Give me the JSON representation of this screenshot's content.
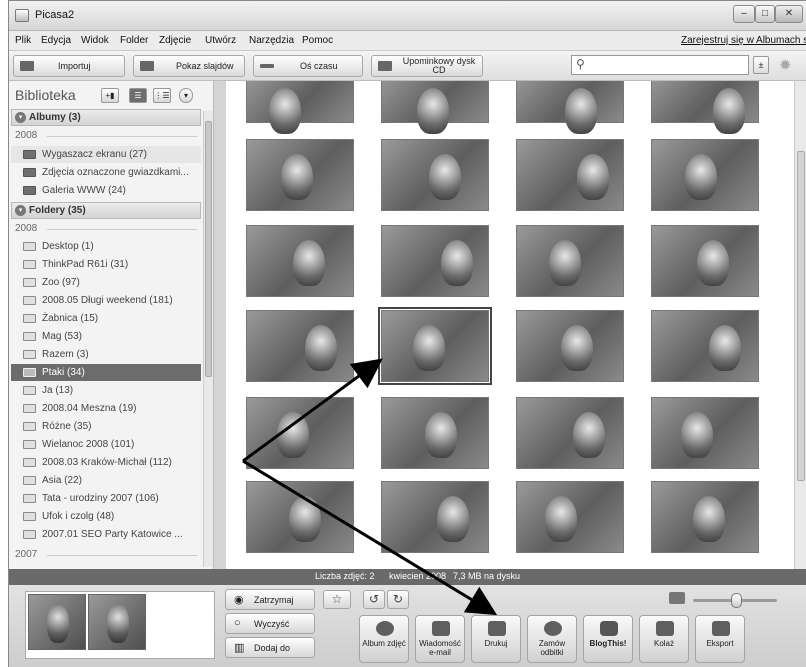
{
  "window": {
    "title": "Picasa2",
    "controls": [
      "–",
      "□",
      "✕"
    ]
  },
  "menu": {
    "items": [
      "Plik",
      "Edycja",
      "Widok",
      "Folder",
      "Zdjęcie",
      "Utwórz",
      "Narzędzia",
      "Pomoc"
    ],
    "register_link": "Zarejestruj się w Albumach sieci"
  },
  "toolbar": {
    "import_label": "Importuj",
    "slideshow_label": "Pokaz slajdów",
    "timeline_label": "Oś czasu",
    "giftcd_label": "Upominkowy dysk CD",
    "search_placeholder": ""
  },
  "sidebar": {
    "title": "Biblioteka",
    "albums_header": "Albumy (3)",
    "albums_year": "2008",
    "albums": [
      "Wygaszacz ekranu (27)",
      "Zdjęcia oznaczone gwiazdkami...",
      "Galeria WWW (24)"
    ],
    "folders_header": "Foldery (35)",
    "folders_year": "2008",
    "folders": [
      "Desktop (1)",
      "ThinkPad R61i (31)",
      "Zoo (97)",
      "2008.05 Długi weekend (181)",
      "Żabnica (15)",
      "Mag (53)",
      "Razem (3)",
      "Ptaki (34)",
      "Ja (13)",
      "2008.04 Meszna (19)",
      "Różne (35)",
      "Wielanoc 2008 (101)",
      "2008.03 Kraków-Michał (112)",
      "Asia (22)",
      "Tata - urodziny 2007 (106)",
      "Ufok i czolg (48)",
      "2007.01 SEO Party Katowice ..."
    ],
    "selected_folder": "Ptaki (34)",
    "next_year": "2007"
  },
  "grid": {
    "photo_count": 24,
    "selected_index": 13
  },
  "status": {
    "selected": "Liczba zdjęć: 2",
    "date": "kwiecień 2008",
    "size": "7,3 MB na dysku"
  },
  "tray": {
    "hold_label": "Zatrzymaj",
    "clear_label": "Wyczyść",
    "add_to_label": "Dodaj do",
    "zoom_level": 0.5
  },
  "actions": [
    {
      "label": "Album zdjęć",
      "icon": "album-icon"
    },
    {
      "label": "Wiadomość e-mail",
      "icon": "email-icon"
    },
    {
      "label": "Drukuj",
      "icon": "printer-icon"
    },
    {
      "label": "Zamów odbitki",
      "icon": "order-prints-icon"
    },
    {
      "label": "BlogThis!",
      "icon": "blogger-icon"
    },
    {
      "label": "Kolaż",
      "icon": "collage-icon"
    },
    {
      "label": "Eksport",
      "icon": "export-icon"
    }
  ]
}
